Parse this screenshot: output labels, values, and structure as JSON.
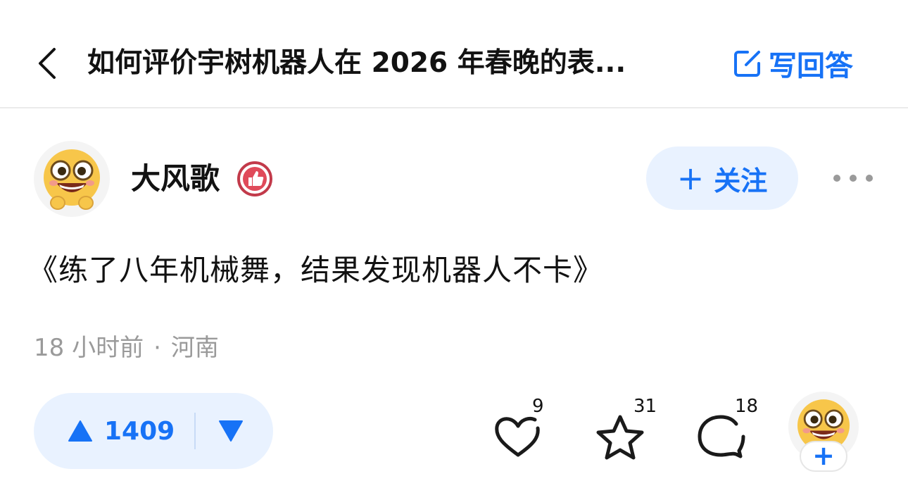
{
  "header": {
    "title": "如何评价宇树机器人在 2026 年春晚的表...",
    "write_answer_label": "写回答"
  },
  "author": {
    "name": "大风歌",
    "follow_label": "关注",
    "follow_plus": "+"
  },
  "answer": {
    "text": "《练了八年机械舞，结果发现机器人不卡》",
    "time": "18 小时前",
    "separator": "·",
    "location": "河南"
  },
  "actions": {
    "upvote_count": "1409",
    "like_count": "9",
    "favorite_count": "31",
    "comment_count": "18",
    "add_label": "+"
  },
  "colors": {
    "accent": "#1772f6",
    "accent_bg": "#e9f2ff",
    "muted_text": "#9a9a9a",
    "badge_red": "#e04a5a"
  },
  "icons": {
    "back": "chevron-left-icon",
    "write": "edit-icon",
    "badge": "thumbs-up-badge-icon",
    "more": "more-dots-icon",
    "upvote": "triangle-up-icon",
    "downvote": "triangle-down-icon",
    "like": "heart-icon",
    "favorite": "star-icon",
    "comment": "comment-bubble-icon"
  }
}
